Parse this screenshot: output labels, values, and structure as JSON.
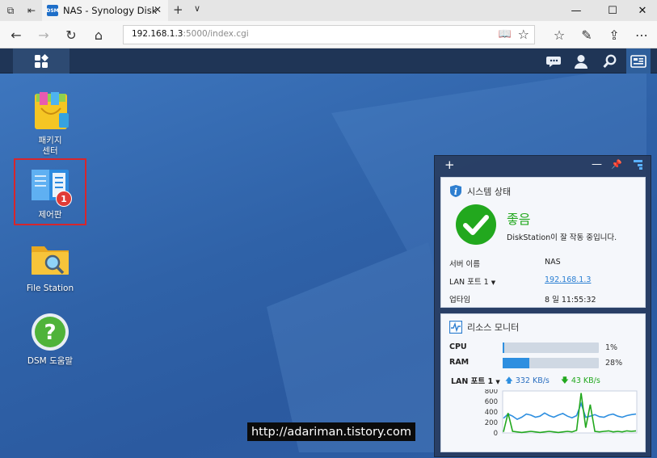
{
  "browser": {
    "tab_title": "NAS - Synology DiskSta",
    "favicon_text": "DSM",
    "address_host": "192.168.1.3",
    "address_path": ":5000/index.cgi"
  },
  "desktop_icons": [
    {
      "label": "패키지\n센터",
      "icon": "package-center-icon"
    },
    {
      "label": "제어판",
      "icon": "control-panel-icon",
      "badge": "1"
    },
    {
      "label": "File Station",
      "icon": "file-station-icon"
    },
    {
      "label": "DSM 도움말",
      "icon": "dsm-help-icon"
    }
  ],
  "system_status": {
    "title": "시스템 상태",
    "status": "좋음",
    "message": "DiskStation이 잘 작동 중입니다.",
    "server_name_label": "서버 이름",
    "server_name": "NAS",
    "lan_label": "LAN 포트 1",
    "lan_value": "192.168.1.3",
    "uptime_label": "업타임",
    "uptime_value": "8 일 11:55:32",
    "status_color": "#22a81e"
  },
  "resource_monitor": {
    "title": "리소스 모니터",
    "cpu_label": "CPU",
    "cpu_pct": "1%",
    "cpu_value": 1,
    "ram_label": "RAM",
    "ram_pct": "28%",
    "ram_value": 28,
    "lan_label": "LAN 포트 1",
    "upload": "332 KB/s",
    "download": "43 KB/s",
    "upload_color": "#2e8fe0",
    "download_color": "#22a81e"
  },
  "chart_data": {
    "type": "line",
    "title": "",
    "ylim": [
      0,
      800
    ],
    "yticks": [
      "800",
      "600",
      "400",
      "200",
      "0"
    ],
    "series": [
      {
        "values": [
          280,
          360,
          320,
          260,
          300,
          360,
          340,
          300,
          320,
          380,
          330,
          300,
          340,
          370,
          320,
          290,
          330,
          560,
          300,
          320,
          350,
          310,
          300,
          340,
          360,
          320,
          300,
          330,
          350,
          360
        ]
      },
      {
        "values": [
          20,
          380,
          30,
          20,
          10,
          20,
          30,
          20,
          10,
          20,
          30,
          20,
          10,
          20,
          30,
          20,
          50,
          760,
          100,
          540,
          30,
          20,
          30,
          40,
          20,
          30,
          20,
          40,
          30,
          40
        ]
      }
    ]
  },
  "watermark": "http://adariman.tistory.com"
}
